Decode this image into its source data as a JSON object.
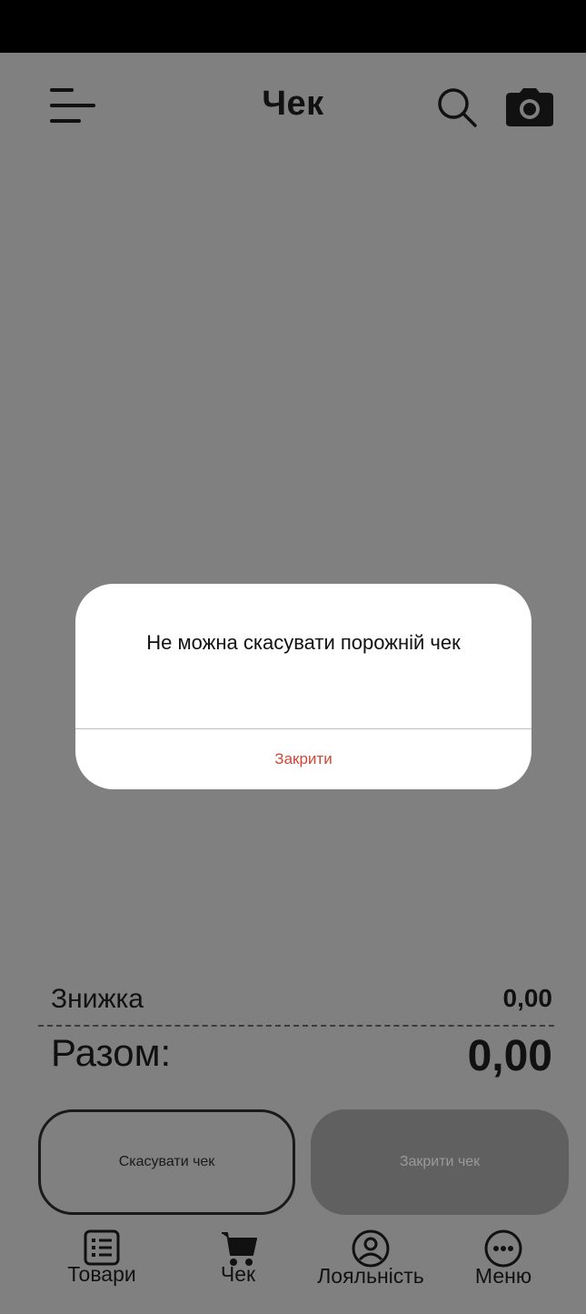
{
  "header": {
    "title": "Чек",
    "menu_icon": "hamburger-icon",
    "search_icon": "search-icon",
    "camera_icon": "camera-icon"
  },
  "summary": {
    "discount_label": "Знижка",
    "discount_value": "0,00",
    "total_label": "Разом:",
    "total_value": "0,00"
  },
  "actions": {
    "cancel_label": "Скасувати чек",
    "close_label": "Закрити чек"
  },
  "tabs": [
    {
      "label": "Товари",
      "icon": "list-icon"
    },
    {
      "label": "Чек",
      "icon": "cart-icon"
    },
    {
      "label": "Лояльність",
      "icon": "user-circle-icon"
    },
    {
      "label": "Меню",
      "icon": "more-icon"
    }
  ],
  "dialog": {
    "message": "Не можна скасувати порожній чек",
    "close_label": "Закрити"
  },
  "colors": {
    "overlay_bg": "#808080",
    "accent": "#d64436"
  }
}
